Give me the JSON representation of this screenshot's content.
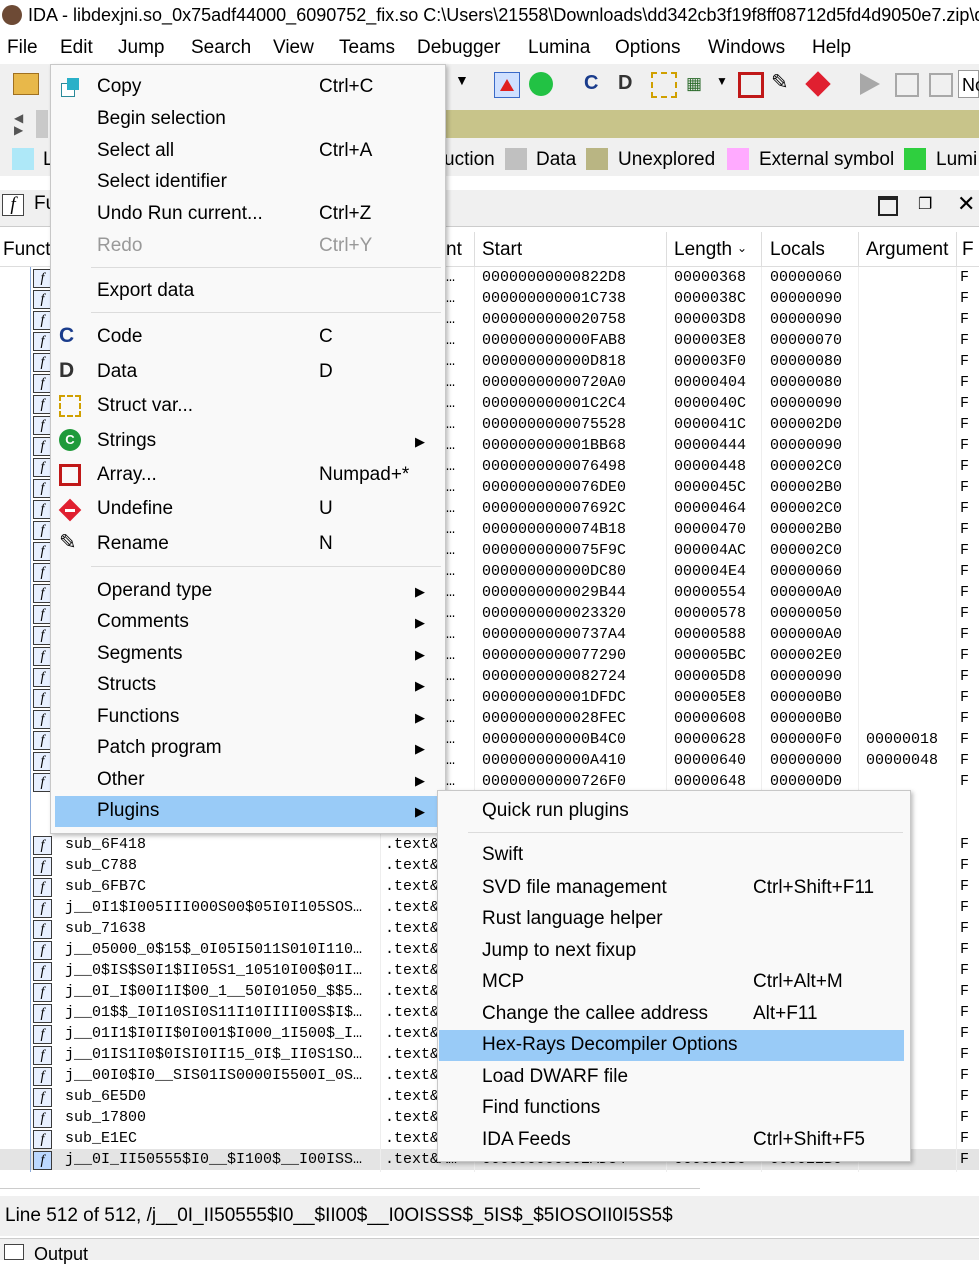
{
  "title_bar": {
    "text": "IDA - libdexjni.so_0x75adf44000_6090752_fix.so C:\\Users\\21558\\Downloads\\dd342cb3f19f8ff08712d5fd4d9050e7.zip\\dd"
  },
  "menubar": [
    "File",
    "Edit",
    "Jump",
    "Search",
    "View",
    "Teams",
    "Debugger",
    "Lumina",
    "Options",
    "Windows",
    "Help"
  ],
  "toolbar": {
    "partial_input": "No"
  },
  "legend": [
    {
      "label": "L",
      "color": "#aee8f8"
    },
    {
      "label": "uction",
      "color": "#c87a8a"
    },
    {
      "label": "Data",
      "color": "#c0c0c0"
    },
    {
      "label": "Unexplored",
      "color": "#b9b583"
    },
    {
      "label": "External symbol",
      "color": "#ffaaff"
    },
    {
      "label": "Lumi",
      "color": "#2fcf3f"
    }
  ],
  "functions_window": {
    "title": "Fu"
  },
  "columns": [
    "Funct",
    "nt",
    "Start",
    "Length",
    "Locals",
    "Argument",
    "F"
  ],
  "rows_upper": [
    {
      "start": "00000000000822D8",
      "length": "00000368",
      "locals": "00000060",
      "args": ""
    },
    {
      "start": "000000000001C738",
      "length": "0000038C",
      "locals": "00000090",
      "args": ""
    },
    {
      "start": "0000000000020758",
      "length": "000003D8",
      "locals": "00000090",
      "args": ""
    },
    {
      "start": "000000000000FAB8",
      "length": "000003E8",
      "locals": "00000070",
      "args": ""
    },
    {
      "start": "000000000000D818",
      "length": "000003F0",
      "locals": "00000080",
      "args": ""
    },
    {
      "start": "00000000000720A0",
      "length": "00000404",
      "locals": "00000080",
      "args": ""
    },
    {
      "start": "000000000001C2C4",
      "length": "0000040C",
      "locals": "00000090",
      "args": ""
    },
    {
      "start": "0000000000075528",
      "length": "0000041C",
      "locals": "000002D0",
      "args": ""
    },
    {
      "start": "000000000001BB68",
      "length": "00000444",
      "locals": "00000090",
      "args": ""
    },
    {
      "start": "0000000000076498",
      "length": "00000448",
      "locals": "000002C0",
      "args": ""
    },
    {
      "start": "0000000000076DE0",
      "length": "0000045C",
      "locals": "000002B0",
      "args": ""
    },
    {
      "start": "000000000007692C",
      "length": "00000464",
      "locals": "000002C0",
      "args": ""
    },
    {
      "start": "0000000000074B18",
      "length": "00000470",
      "locals": "000002B0",
      "args": ""
    },
    {
      "start": "0000000000075F9C",
      "length": "000004AC",
      "locals": "000002C0",
      "args": ""
    },
    {
      "start": "000000000000DC80",
      "length": "000004E4",
      "locals": "00000060",
      "args": ""
    },
    {
      "start": "0000000000029B44",
      "length": "00000554",
      "locals": "000000A0",
      "args": ""
    },
    {
      "start": "0000000000023320",
      "length": "00000578",
      "locals": "00000050",
      "args": ""
    },
    {
      "start": "00000000000737A4",
      "length": "00000588",
      "locals": "000000A0",
      "args": ""
    },
    {
      "start": "0000000000077290",
      "length": "000005BC",
      "locals": "000002E0",
      "args": ""
    },
    {
      "start": "0000000000082724",
      "length": "000005D8",
      "locals": "00000090",
      "args": ""
    },
    {
      "start": "000000000001DFDC",
      "length": "000005E8",
      "locals": "000000B0",
      "args": ""
    },
    {
      "start": "0000000000028FEC",
      "length": "00000608",
      "locals": "000000B0",
      "args": ""
    },
    {
      "start": "000000000000B4C0",
      "length": "00000628",
      "locals": "000000F0",
      "args": "00000018"
    },
    {
      "start": "000000000000A410",
      "length": "00000640",
      "locals": "00000000",
      "args": "00000048"
    },
    {
      "start": "00000000000726F0",
      "length": "00000648",
      "locals": "000000D0",
      "args": ""
    }
  ],
  "rows_lower": [
    {
      "name": "sub_6F418",
      "segment": ".text&"
    },
    {
      "name": "sub_C788",
      "segment": ".text&"
    },
    {
      "name": "sub_6FB7C",
      "segment": ".text&"
    },
    {
      "name": "j__0I1$I005III000S00$05I0I105SOS…",
      "segment": ".text&"
    },
    {
      "name": "sub_71638",
      "segment": ".text&"
    },
    {
      "name": "j__05000_0$15$_0I05I5011S010I110…",
      "segment": ".text&"
    },
    {
      "name": "j__0$IS$S0I1$II05S1_10510I00$01I…",
      "segment": ".text&"
    },
    {
      "name": "j__0I_I$00I1I$00_1__50I01050_$$5…",
      "segment": ".text&"
    },
    {
      "name": "j__01$$_I0I10SI0S11I10IIII00S$I$…",
      "segment": ".text&"
    },
    {
      "name": "j__01I1$I0II$0I001$I000_1I500$_I…",
      "segment": ".text&"
    },
    {
      "name": "j__01IS1I0$0ISI0II15_0I$_II0S1SO…",
      "segment": ".text&"
    },
    {
      "name": "j__00I0$I0__SIS01IS0000I5500I_0S…",
      "segment": ".text&"
    },
    {
      "name": "sub_6E5D0",
      "segment": ".text&"
    },
    {
      "name": "sub_17800",
      "segment": ".text&"
    },
    {
      "name": "sub_E1EC",
      "segment": ".text&"
    },
    {
      "name": "j__0I_II50555$I0__$I100$__I00ISS…",
      "segment": ".text&A…",
      "start": "000000000002AD34",
      "length": "0003D0B0",
      "locals": "000022B0"
    }
  ],
  "edit_menu": {
    "items": [
      {
        "label": "Copy",
        "shortcut": "Ctrl+C",
        "icon": "copy-icon"
      },
      {
        "label": "Begin selection",
        "shortcut": ""
      },
      {
        "label": "Select all",
        "shortcut": "Ctrl+A"
      },
      {
        "label": "Select identifier",
        "shortcut": ""
      },
      {
        "label": "Undo Run current...",
        "shortcut": "Ctrl+Z"
      },
      {
        "label": "Redo",
        "shortcut": "Ctrl+Y",
        "disabled": true
      },
      {
        "label": "Export data",
        "shortcut": ""
      },
      {
        "label": "Code",
        "shortcut": "C",
        "icon": "code-icon"
      },
      {
        "label": "Data",
        "shortcut": "D",
        "icon": "data-icon"
      },
      {
        "label": "Struct var...",
        "shortcut": "",
        "icon": "struct-icon"
      },
      {
        "label": "Strings",
        "shortcut": "",
        "icon": "strings-icon",
        "submenu": true
      },
      {
        "label": "Array...",
        "shortcut": "Numpad+*",
        "icon": "array-icon"
      },
      {
        "label": "Undefine",
        "shortcut": "U",
        "icon": "undefine-icon"
      },
      {
        "label": "Rename",
        "shortcut": "N",
        "icon": "rename-icon"
      },
      {
        "label": "Operand type",
        "submenu": true
      },
      {
        "label": "Comments",
        "submenu": true
      },
      {
        "label": "Segments",
        "submenu": true
      },
      {
        "label": "Structs",
        "submenu": true
      },
      {
        "label": "Functions",
        "submenu": true
      },
      {
        "label": "Patch program",
        "submenu": true
      },
      {
        "label": "Other",
        "submenu": true
      },
      {
        "label": "Plugins",
        "submenu": true,
        "highlighted": true
      }
    ]
  },
  "plugins_menu": {
    "items": [
      {
        "label": "Quick run plugins",
        "shortcut": ""
      },
      {
        "label": "Swift",
        "shortcut": ""
      },
      {
        "label": "SVD file management",
        "shortcut": "Ctrl+Shift+F11"
      },
      {
        "label": "Rust language helper",
        "shortcut": ""
      },
      {
        "label": "Jump to next fixup",
        "shortcut": ""
      },
      {
        "label": "MCP",
        "shortcut": "Ctrl+Alt+M"
      },
      {
        "label": "Change the callee address",
        "shortcut": "Alt+F11"
      },
      {
        "label": "Hex-Rays Decompiler Options",
        "shortcut": "",
        "highlighted": true
      },
      {
        "label": "Load DWARF file",
        "shortcut": ""
      },
      {
        "label": "Find functions",
        "shortcut": ""
      },
      {
        "label": "IDA Feeds",
        "shortcut": "Ctrl+Shift+F5"
      }
    ]
  },
  "status": {
    "line": "Line 512 of 512, /j__0I_II50555$I0__$II00$__I0OISSS$_5IS$_$5IOSOII0I5S5$"
  },
  "output_tab": {
    "label": "Output"
  },
  "colors": {
    "menu_highlight": "#99cbf7",
    "nav_band": "#c8c48a"
  }
}
